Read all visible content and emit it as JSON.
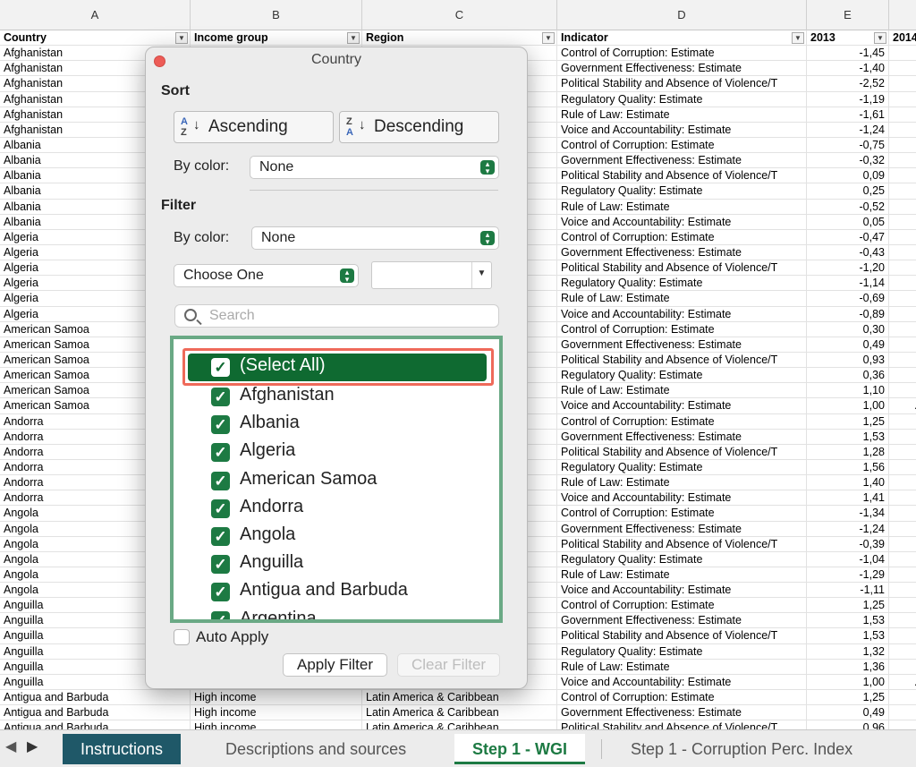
{
  "sheet": {
    "columns": [
      {
        "letter": "A",
        "header": "Country"
      },
      {
        "letter": "B",
        "header": "Income group"
      },
      {
        "letter": "C",
        "header": "Region"
      },
      {
        "letter": "D",
        "header": "Indicator"
      },
      {
        "letter": "E",
        "header": "2013"
      },
      {
        "letter": "",
        "header": "2014"
      }
    ],
    "rows": [
      [
        "Afghanistan",
        "",
        "",
        "Control of Corruption: Estimate",
        "-1,45",
        ""
      ],
      [
        "Afghanistan",
        "",
        "",
        "Government Effectiveness: Estimate",
        "-1,40",
        ""
      ],
      [
        "Afghanistan",
        "",
        "",
        "Political Stability and Absence of Violence/T",
        "-2,52",
        ""
      ],
      [
        "Afghanistan",
        "",
        "",
        "Regulatory Quality: Estimate",
        "-1,19",
        ""
      ],
      [
        "Afghanistan",
        "",
        "",
        "Rule of Law: Estimate",
        "-1,61",
        ""
      ],
      [
        "Afghanistan",
        "",
        "",
        "Voice and Accountability: Estimate",
        "-1,24",
        ""
      ],
      [
        "Albania",
        "",
        "",
        "Control of Corruption: Estimate",
        "-0,75",
        ""
      ],
      [
        "Albania",
        "",
        "",
        "Government Effectiveness: Estimate",
        "-0,32",
        ""
      ],
      [
        "Albania",
        "",
        "",
        "Political Stability and Absence of Violence/T",
        "0,09",
        ""
      ],
      [
        "Albania",
        "",
        "",
        "Regulatory Quality: Estimate",
        "0,25",
        ""
      ],
      [
        "Albania",
        "",
        "",
        "Rule of Law: Estimate",
        "-0,52",
        ""
      ],
      [
        "Albania",
        "",
        "",
        "Voice and Accountability: Estimate",
        "0,05",
        ""
      ],
      [
        "Algeria",
        "",
        "",
        "Control of Corruption: Estimate",
        "-0,47",
        ""
      ],
      [
        "Algeria",
        "",
        "",
        "Government Effectiveness: Estimate",
        "-0,43",
        ""
      ],
      [
        "Algeria",
        "",
        "",
        "Political Stability and Absence of Violence/T",
        "-1,20",
        ""
      ],
      [
        "Algeria",
        "",
        "",
        "Regulatory Quality: Estimate",
        "-1,14",
        ""
      ],
      [
        "Algeria",
        "",
        "",
        "Rule of Law: Estimate",
        "-0,69",
        ""
      ],
      [
        "Algeria",
        "",
        "",
        "Voice and Accountability: Estimate",
        "-0,89",
        ""
      ],
      [
        "American Samoa",
        "",
        "",
        "Control of Corruption: Estimate",
        "0,30",
        ""
      ],
      [
        "American Samoa",
        "",
        "",
        "Government Effectiveness: Estimate",
        "0,49",
        ""
      ],
      [
        "American Samoa",
        "",
        "",
        "Political Stability and Absence of Violence/T",
        "0,93",
        ""
      ],
      [
        "American Samoa",
        "",
        "",
        "Regulatory Quality: Estimate",
        "0,36",
        ""
      ],
      [
        "American Samoa",
        "",
        "",
        "Rule of Law: Estimate",
        "1,10",
        ""
      ],
      [
        "American Samoa",
        "",
        "",
        "Voice and Accountability: Estimate",
        "1,00",
        ".."
      ],
      [
        "Andorra",
        "",
        "",
        "Control of Corruption: Estimate",
        "1,25",
        ""
      ],
      [
        "Andorra",
        "",
        "",
        "Government Effectiveness: Estimate",
        "1,53",
        ""
      ],
      [
        "Andorra",
        "",
        "",
        "Political Stability and Absence of Violence/T",
        "1,28",
        ""
      ],
      [
        "Andorra",
        "",
        "",
        "Regulatory Quality: Estimate",
        "1,56",
        ""
      ],
      [
        "Andorra",
        "",
        "",
        "Rule of Law: Estimate",
        "1,40",
        ""
      ],
      [
        "Andorra",
        "",
        "",
        "Voice and Accountability: Estimate",
        "1,41",
        ""
      ],
      [
        "Angola",
        "",
        "",
        "Control of Corruption: Estimate",
        "-1,34",
        ""
      ],
      [
        "Angola",
        "",
        "",
        "Government Effectiveness: Estimate",
        "-1,24",
        ""
      ],
      [
        "Angola",
        "",
        "",
        "Political Stability and Absence of Violence/T",
        "-0,39",
        ""
      ],
      [
        "Angola",
        "",
        "",
        "Regulatory Quality: Estimate",
        "-1,04",
        ""
      ],
      [
        "Angola",
        "",
        "",
        "Rule of Law: Estimate",
        "-1,29",
        ""
      ],
      [
        "Angola",
        "",
        "",
        "Voice and Accountability: Estimate",
        "-1,11",
        ""
      ],
      [
        "Anguilla",
        "",
        "",
        "Control of Corruption: Estimate",
        "1,25",
        ""
      ],
      [
        "Anguilla",
        "",
        "",
        "Government Effectiveness: Estimate",
        "1,53",
        ""
      ],
      [
        "Anguilla",
        "",
        "",
        "Political Stability and Absence of Violence/T",
        "1,53",
        ""
      ],
      [
        "Anguilla",
        "",
        "",
        "Regulatory Quality: Estimate",
        "1,32",
        ""
      ],
      [
        "Anguilla",
        "",
        "",
        "Rule of Law: Estimate",
        "1,36",
        ""
      ],
      [
        "Anguilla",
        "",
        "",
        "Voice and Accountability: Estimate",
        "1,00",
        ".."
      ],
      [
        "Antigua and Barbuda",
        "High income",
        "Latin America & Caribbean",
        "Control of Corruption: Estimate",
        "1,25",
        ""
      ],
      [
        "Antigua and Barbuda",
        "High income",
        "Latin America & Caribbean",
        "Government Effectiveness: Estimate",
        "0,49",
        ""
      ],
      [
        "Antigua and Barbuda",
        "High income",
        "Latin America & Caribbean",
        "Political Stability and Absence of Violence/T",
        "0,96",
        ""
      ]
    ]
  },
  "dialog": {
    "title": "Country",
    "sort_label": "Sort",
    "ascending_label": "Ascending",
    "descending_label": "Descending",
    "by_color_label": "By color:",
    "sort_color_value": "None",
    "filter_label": "Filter",
    "filter_color_value": "None",
    "choose_one": "Choose One",
    "search_placeholder": "Search",
    "select_all": "(Select All)",
    "items": [
      "Afghanistan",
      "Albania",
      "Algeria",
      "American Samoa",
      "Andorra",
      "Angola",
      "Anguilla",
      "Antigua and Barbuda",
      "Argentina"
    ],
    "auto_apply": "Auto Apply",
    "apply_filter": "Apply Filter",
    "clear_filter": "Clear Filter"
  },
  "tabs": [
    "Instructions",
    "Descriptions and sources",
    "Step 1 - WGI",
    "Step 1 - Corruption Perc. Index"
  ],
  "colors": {
    "accent_green": "#1d7a43",
    "instructions_tab": "#1f5868",
    "highlight_outline": "#ef6a5a"
  }
}
